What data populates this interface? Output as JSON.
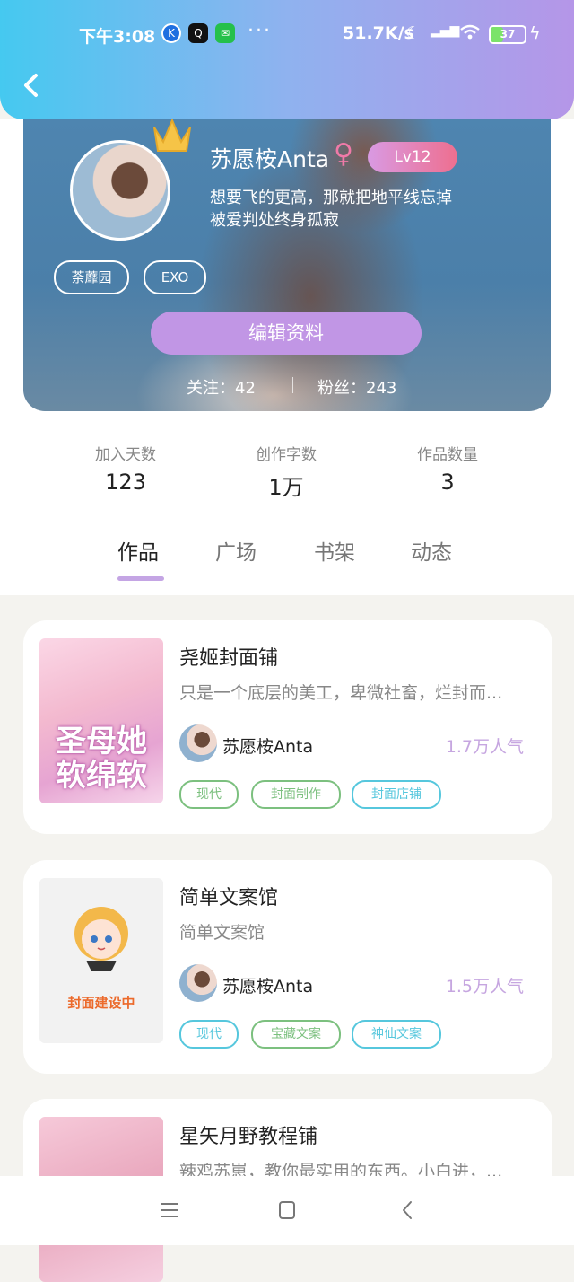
{
  "status_bar": {
    "time": "下午3:08",
    "net_speed": "51.7K/s",
    "battery": "37",
    "icons": [
      "k-app-icon",
      "qq-icon",
      "wechat-icon",
      "more-dots-icon",
      "moon-icon",
      "signal-icon",
      "wifi-icon",
      "battery-icon",
      "charging-icon"
    ]
  },
  "profile": {
    "username": "苏愿桉Anta",
    "gender_symbol": "♀",
    "level": "Lv12",
    "bio_line1": "想要飞的更高，那就把地平线忘掉",
    "bio_line2": "被爱判处终身孤寂",
    "tags": [
      "荼蘼园",
      "EXO"
    ],
    "edit_label": "编辑资料",
    "following_text": "关注：42",
    "followers_text": "粉丝：243"
  },
  "stats": [
    {
      "label": "加入天数",
      "value": "123"
    },
    {
      "label": "创作字数",
      "value": "1万"
    },
    {
      "label": "作品数量",
      "value": "3"
    }
  ],
  "tabs": [
    "作品",
    "广场",
    "书架",
    "动态"
  ],
  "works": [
    {
      "title": "尧姬封面铺",
      "desc": "只是一个底层的美工，卑微社畜，烂封而...",
      "author": "苏愿桉Anta",
      "popularity": "1.7万人气",
      "cover_text": "圣母她软绵软",
      "tags": [
        {
          "label": "现代",
          "color": "#7cc07f"
        },
        {
          "label": "封面制作",
          "color": "#7cc07f"
        },
        {
          "label": "封面店铺",
          "color": "#56c7dd"
        }
      ]
    },
    {
      "title": "简单文案馆",
      "desc": "简单文案馆",
      "author": "苏愿桉Anta",
      "popularity": "1.5万人气",
      "cover_text": "封面建设中",
      "tags": [
        {
          "label": "现代",
          "color": "#56c7dd"
        },
        {
          "label": "宝藏文案",
          "color": "#7cc07f"
        },
        {
          "label": "神仙文案",
          "color": "#56c7dd"
        }
      ]
    },
    {
      "title": "星矢月野教程铺",
      "desc": "辣鸡苏崽，教你最实用的东西。小白进，...",
      "author": "",
      "popularity": "",
      "tags": []
    }
  ],
  "colors": {
    "accent_purple": "#c196e5",
    "tab_indicator": "#c4a5e4",
    "popularity": "#c6a6e0"
  }
}
